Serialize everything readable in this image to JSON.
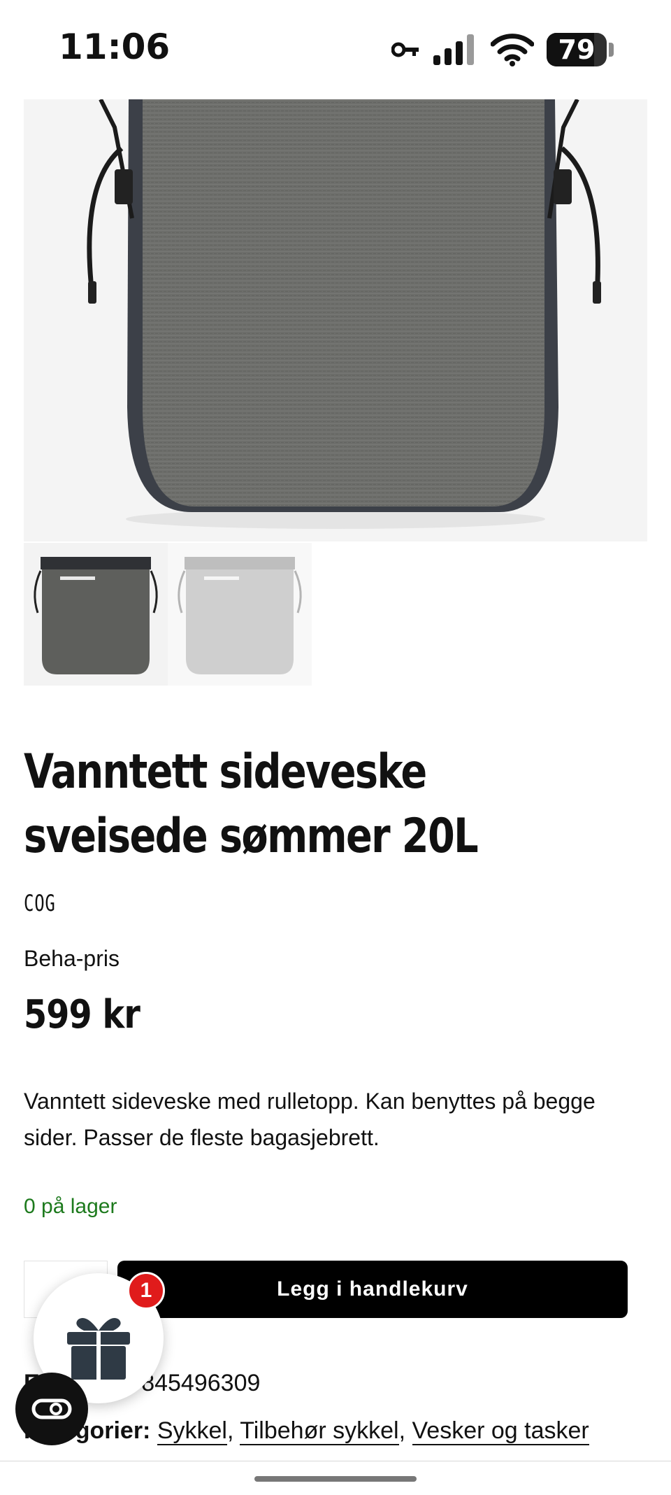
{
  "status_bar": {
    "time": "11:06",
    "battery": 79
  },
  "product": {
    "title": "Vanntett sideveske sveisede sømmer 20L",
    "brand": "COG",
    "price_label": "Beha-pris",
    "price": "599 kr",
    "description": "Vanntett sideveske med rulletopp. Kan benyttes på begge sider. Passer de fleste bagasjebrett.",
    "stock": "0 på lager",
    "add_to_cart_label": "Legg i handlekurv",
    "sku_label": "EAN:",
    "sku_value": "7070845496309",
    "categories_label": "Kategorier:",
    "categories": [
      "Sykkel",
      "Tilbehør sykkel",
      "Vesker og tasker"
    ]
  },
  "gift_widget": {
    "badge_count": "1"
  },
  "colors": {
    "stock_green": "#1d7a1d",
    "badge_red": "#e01b1b",
    "button_black": "#000000"
  }
}
